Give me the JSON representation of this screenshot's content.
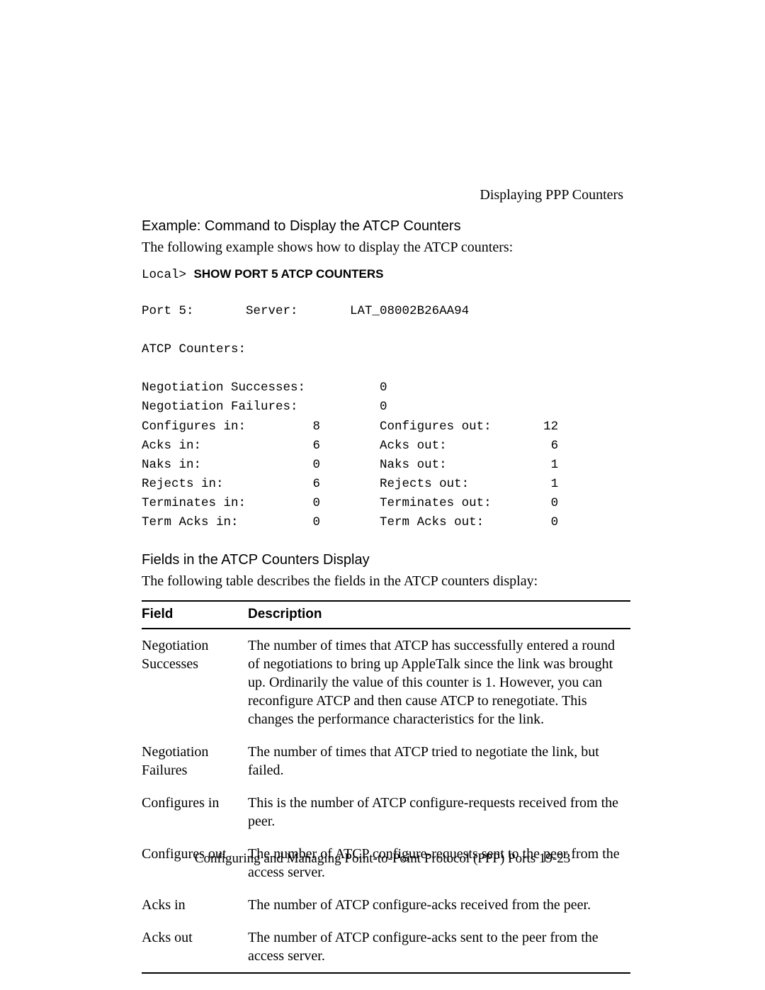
{
  "header": {
    "right": "Displaying PPP Counters"
  },
  "example": {
    "heading": "Example: Command to Display the ATCP Counters",
    "intro": "The following example shows how to display the ATCP counters:",
    "prompt": "Local> ",
    "command": "SHOW PORT 5 ATCP COUNTERS"
  },
  "terminal": {
    "port_label": "Port 5:",
    "server_label": "Server:",
    "server_name": "LAT_08002B26AA94",
    "section_heading": "ATCP Counters:",
    "neg_succ_label": "Negotiation Successes:",
    "neg_succ_value": "0",
    "neg_fail_label": "Negotiation Failures:",
    "neg_fail_value": "0",
    "rows": [
      {
        "l_label": "Configures in:",
        "l_value": "8",
        "r_label": "Configures out:",
        "r_value": "12"
      },
      {
        "l_label": "Acks in:",
        "l_value": "6",
        "r_label": "Acks out:",
        "r_value": "6"
      },
      {
        "l_label": "Naks in:",
        "l_value": "0",
        "r_label": "Naks out:",
        "r_value": "1"
      },
      {
        "l_label": "Rejects in:",
        "l_value": "6",
        "r_label": "Rejects out:",
        "r_value": "1"
      },
      {
        "l_label": "Terminates in:",
        "l_value": "0",
        "r_label": "Terminates out:",
        "r_value": "0"
      },
      {
        "l_label": "Term Acks in:",
        "l_value": "0",
        "r_label": "Term Acks out:",
        "r_value": "0"
      }
    ]
  },
  "fields_section": {
    "heading": "Fields in the ATCP Counters Display",
    "intro": "The following table describes the fields in the ATCP counters display:",
    "col_field": "Field",
    "col_desc": "Description",
    "rows": [
      {
        "field": "Negotiation Successes",
        "desc": "The number of times that ATCP has successfully entered a round of negotiations to bring up AppleTalk since the link was brought up. Ordinarily the value of this counter is 1. However, you can reconfigure ATCP and then cause ATCP to renegotiate. This changes the performance characteristics for the link."
      },
      {
        "field": "Negotiation Failures",
        "desc": "The number of times that ATCP tried to negotiate the link, but failed."
      },
      {
        "field": "Configures in",
        "desc": "This is the number of ATCP configure-requests received from the peer."
      },
      {
        "field": "Configures out",
        "desc": "The number of ATCP configure-requests sent to the peer from the access server."
      },
      {
        "field": "Acks in",
        "desc": "The number of ATCP configure-acks received from the peer."
      },
      {
        "field": "Acks out",
        "desc": "The number of ATCP configure-acks sent to the peer from the access server."
      }
    ]
  },
  "footer": {
    "text": "Configuring and Managing Point-to-Point Protocol (PPP) Ports 19-23"
  }
}
